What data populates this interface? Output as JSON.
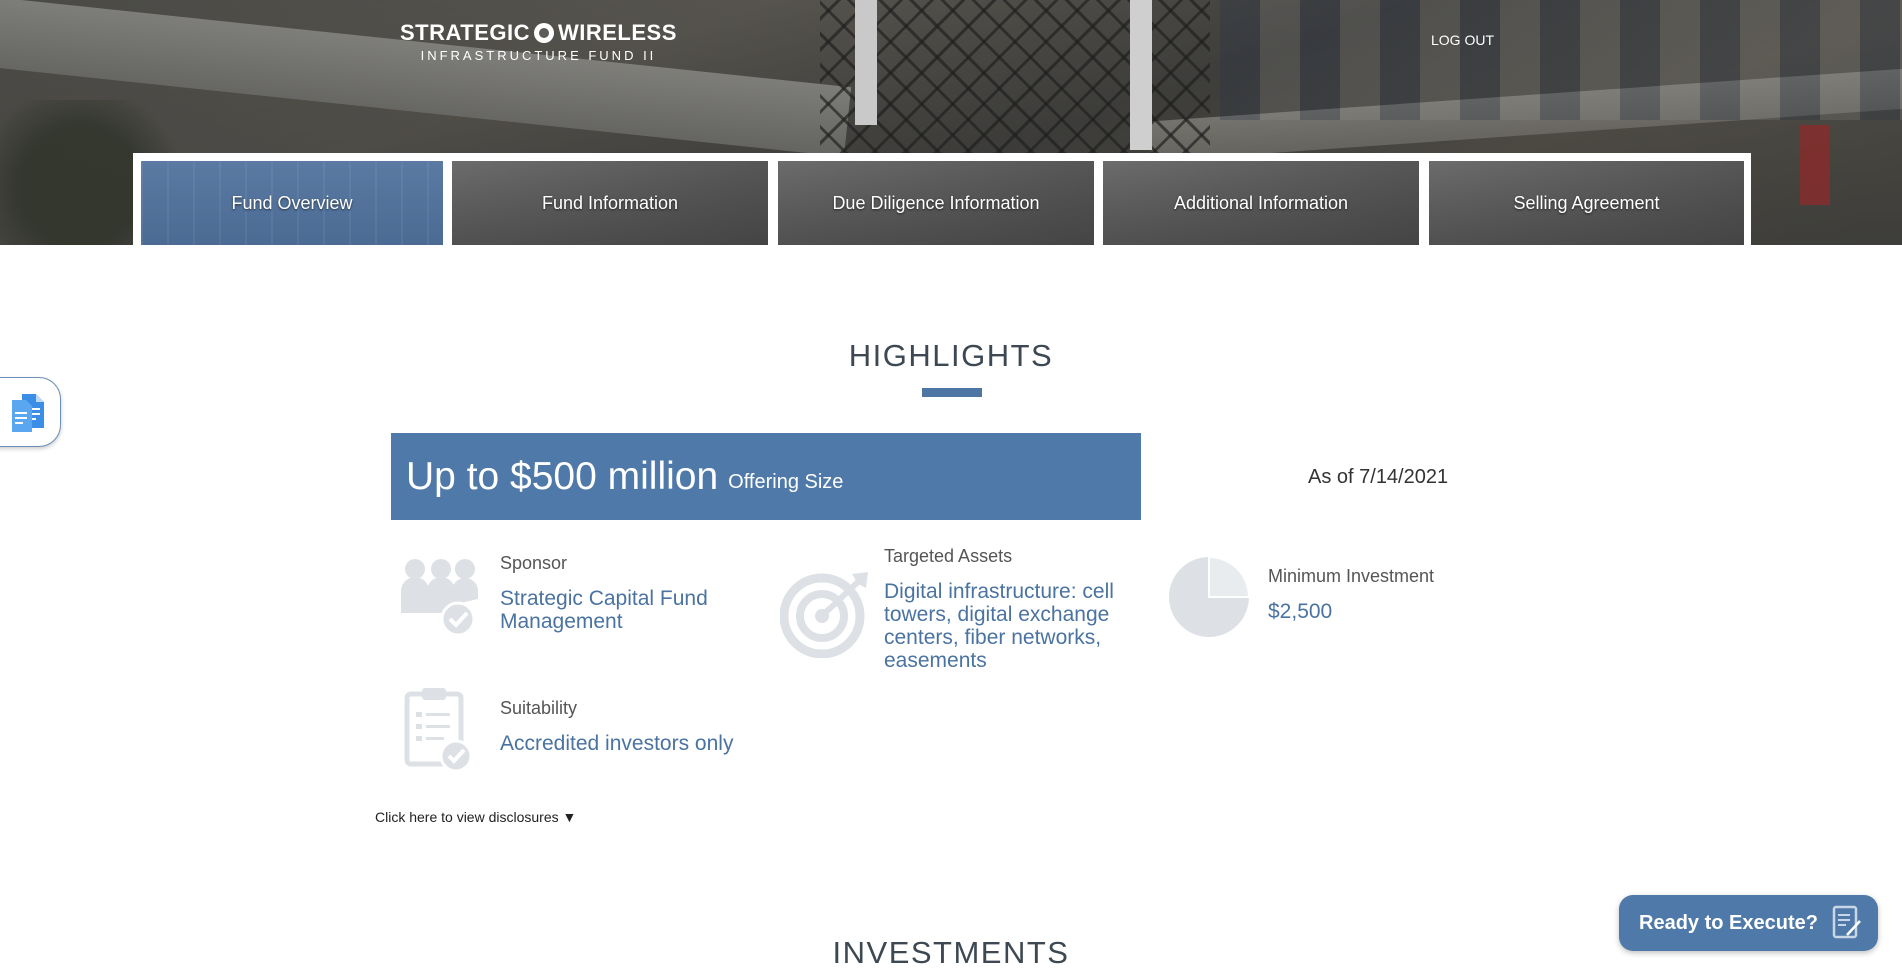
{
  "header": {
    "logo_line1_a": "STRATEGIC",
    "logo_line1_b": "WIRELESS",
    "logo_line2": "INFRASTRUCTURE FUND II",
    "logout_label": "LOG OUT"
  },
  "nav": {
    "tabs": [
      {
        "label": "Fund Overview",
        "active": true
      },
      {
        "label": "Fund Information",
        "active": false
      },
      {
        "label": "Due Diligence Information",
        "active": false
      },
      {
        "label": "Additional Information",
        "active": false
      },
      {
        "label": "Selling Agreement",
        "active": false
      }
    ]
  },
  "highlights": {
    "title": "HIGHLIGHTS",
    "offering_amount": "Up to $500 million",
    "offering_label": "Offering Size",
    "as_of": "As of 7/14/2021",
    "sponsor": {
      "label": "Sponsor",
      "value": "Strategic Capital Fund Management"
    },
    "targeted_assets": {
      "label": "Targeted Assets",
      "value": "Digital infrastructure: cell towers, digital exchange centers, fiber networks, easements"
    },
    "minimum_investment": {
      "label": "Minimum Investment",
      "value": "$2,500"
    },
    "suitability": {
      "label": "Suitability",
      "value": "Accredited investors only"
    },
    "disclosure_link": "Click here to view disclosures ▼"
  },
  "investments": {
    "title": "INVESTMENTS"
  },
  "floating": {
    "ready_button": "Ready to Execute?"
  },
  "colors": {
    "accent": "#4f79a9",
    "icon_gray": "#dde1e6",
    "title_text": "#3d4852"
  }
}
